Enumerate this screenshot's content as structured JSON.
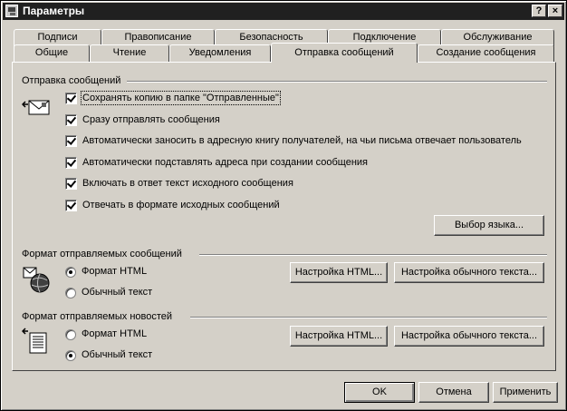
{
  "window": {
    "title": "Параметры",
    "help_btn": "?",
    "close_btn": "×"
  },
  "tabs_back": [
    "Подписи",
    "Правописание",
    "Безопасность",
    "Подключение",
    "Обслуживание"
  ],
  "tabs_front": [
    "Общие",
    "Чтение",
    "Уведомления",
    "Отправка сообщений",
    "Создание сообщения"
  ],
  "send": {
    "group_label": "Отправка сообщений",
    "options": [
      "Сохранять копию в папке \"Отправленные\"",
      "Сразу отправлять сообщения",
      "Автоматически заносить в адресную книгу получателей, на чьи письма отвечает пользователь",
      "Автоматически подставлять адреса при создании сообщения",
      "Включать в ответ текст исходного сообщения",
      "Отвечать в формате исходных сообщений"
    ],
    "lang_button": "Выбор языка..."
  },
  "mail_format": {
    "group_label": "Формат отправляемых сообщений",
    "html": "Формат HTML",
    "plain": "Обычный текст",
    "selected": "html",
    "html_settings": "Настройка HTML...",
    "plain_settings": "Настройка обычного текста..."
  },
  "news_format": {
    "group_label": "Формат отправляемых новостей",
    "html": "Формат HTML",
    "plain": "Обычный текст",
    "selected": "plain",
    "html_settings": "Настройка HTML...",
    "plain_settings": "Настройка обычного текста..."
  },
  "footer": {
    "ok": "OK",
    "cancel": "Отмена",
    "apply": "Применить"
  }
}
